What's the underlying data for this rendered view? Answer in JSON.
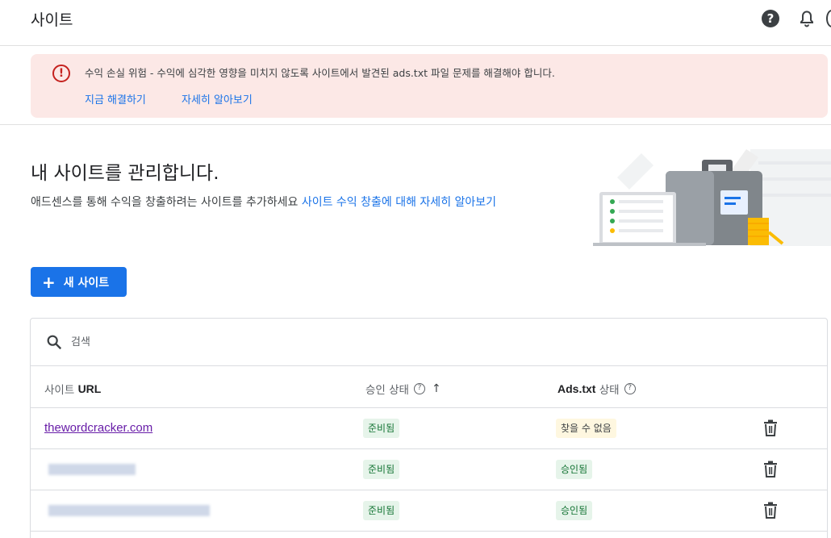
{
  "header": {
    "title": "사이트"
  },
  "icons": {
    "help": "help-circle-icon",
    "notifications": "bell-icon"
  },
  "alert": {
    "message": "수익 손실 위험 - 수익에 심각한 영향을 미치지 않도록 사이트에서 발견된 ads.txt 파일 문제를 해결해야 합니다.",
    "fix_link": "지금 해결하기",
    "learn_link": "자세히 알아보기",
    "color": "#fce8e6"
  },
  "hero": {
    "title": "내 사이트를 관리합니다.",
    "description": "애드센스를 통해 수익을 창출하려는 사이트를 추가하세요",
    "link": "사이트 수익 창출에 대해 자세히 알아보기"
  },
  "new_site_button": {
    "plus": "+",
    "label": "새 사이트"
  },
  "search": {
    "placeholder": "검색"
  },
  "table": {
    "headers": {
      "site_prefix": "사이트",
      "site_bold": "URL",
      "approval": "승인 상태",
      "adstxt_bold": "Ads.txt",
      "adstxt_suffix": "상태"
    },
    "rows": [
      {
        "url": "thewordcracker.com",
        "approval": "준비됨",
        "adstxt": "찾을 수 없음"
      },
      {
        "url": "",
        "approval": "준비됨",
        "adstxt": "승인됨"
      },
      {
        "url": "",
        "approval": "준비됨",
        "adstxt": "승인됨"
      }
    ]
  },
  "colors": {
    "accent": "#1a73e8",
    "ready_bg": "#e6f4ea",
    "warn_bg": "#fef7e0",
    "link_visited": "#681da8"
  }
}
